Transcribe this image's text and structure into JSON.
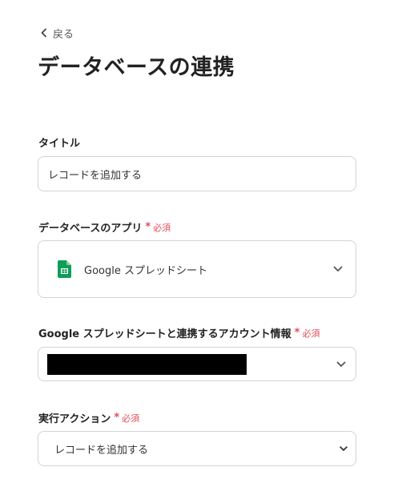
{
  "nav": {
    "back_label": "戻る"
  },
  "page": {
    "title": "データベースの連携"
  },
  "fields": {
    "title_field": {
      "label": "タイトル",
      "value": "レコードを追加する"
    },
    "database_app": {
      "label": "データベースのアプリ",
      "required": "必須",
      "value": "Google スプレッドシート",
      "icon": "google-sheets-icon"
    },
    "account": {
      "label": "Google スプレッドシートと連携するアカウント情報",
      "required": "必須"
    },
    "action": {
      "label": "実行アクション",
      "required": "必須",
      "value": "レコードを追加する"
    }
  },
  "colors": {
    "required": "#e24b5b",
    "sheets_green": "#0f9d58",
    "border": "#cfd4da"
  }
}
